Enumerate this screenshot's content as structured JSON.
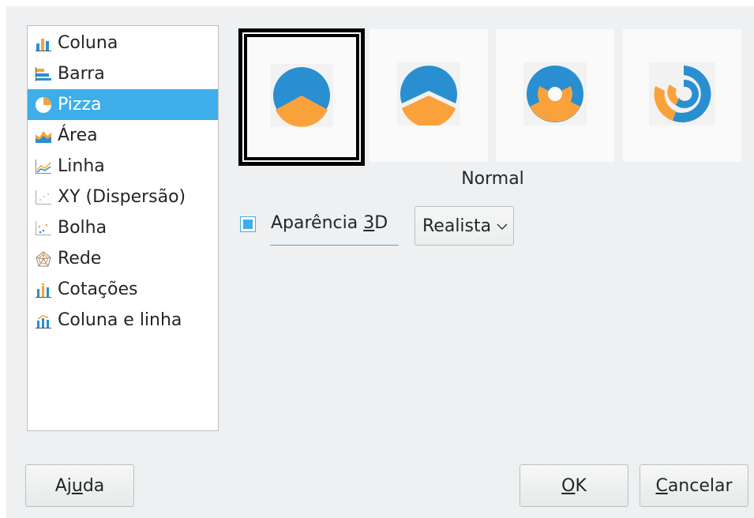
{
  "chart_types": [
    {
      "label": "Coluna",
      "icon": "column-chart-icon",
      "selected": false
    },
    {
      "label": "Barra",
      "icon": "bar-chart-icon",
      "selected": false
    },
    {
      "label": "Pizza",
      "icon": "pie-chart-icon",
      "selected": true
    },
    {
      "label": "Área",
      "icon": "area-chart-icon",
      "selected": false
    },
    {
      "label": "Linha",
      "icon": "line-chart-icon",
      "selected": false
    },
    {
      "label": "XY (Dispersão)",
      "icon": "xy-scatter-chart-icon",
      "selected": false
    },
    {
      "label": "Bolha",
      "icon": "bubble-chart-icon",
      "selected": false
    },
    {
      "label": "Rede",
      "icon": "net-chart-icon",
      "selected": false
    },
    {
      "label": "Cotações",
      "icon": "stock-chart-icon",
      "selected": false
    },
    {
      "label": "Coluna e linha",
      "icon": "column-and-line-chart-icon",
      "selected": false
    }
  ],
  "variants": {
    "items": [
      {
        "name": "variant-normal-pie",
        "icon": "pie-normal-icon",
        "selected": true
      },
      {
        "name": "variant-exploded-pie",
        "icon": "pie-exploded-icon",
        "selected": false
      },
      {
        "name": "variant-donut",
        "icon": "donut-icon",
        "selected": false
      },
      {
        "name": "variant-exploded-donut",
        "icon": "donut-exploded-icon",
        "selected": false
      }
    ],
    "selected_caption": "Normal"
  },
  "appearance_3d": {
    "label_before": "Aparência ",
    "label_mnemonic": "3",
    "label_after": "D",
    "checked": true
  },
  "scheme": {
    "selected_value": "Realista"
  },
  "buttons": {
    "help": {
      "before": "Aj",
      "mnemonic": "u",
      "after": "da"
    },
    "ok": {
      "before": "",
      "mnemonic": "O",
      "after": "K"
    },
    "cancel": {
      "before": "",
      "mnemonic": "C",
      "after": "ancelar"
    }
  },
  "colors": {
    "accent": "#3daee9",
    "pie_blue": "#2a8fd0",
    "pie_orange": "#f9a23b",
    "window_bg": "#eff0f1"
  }
}
